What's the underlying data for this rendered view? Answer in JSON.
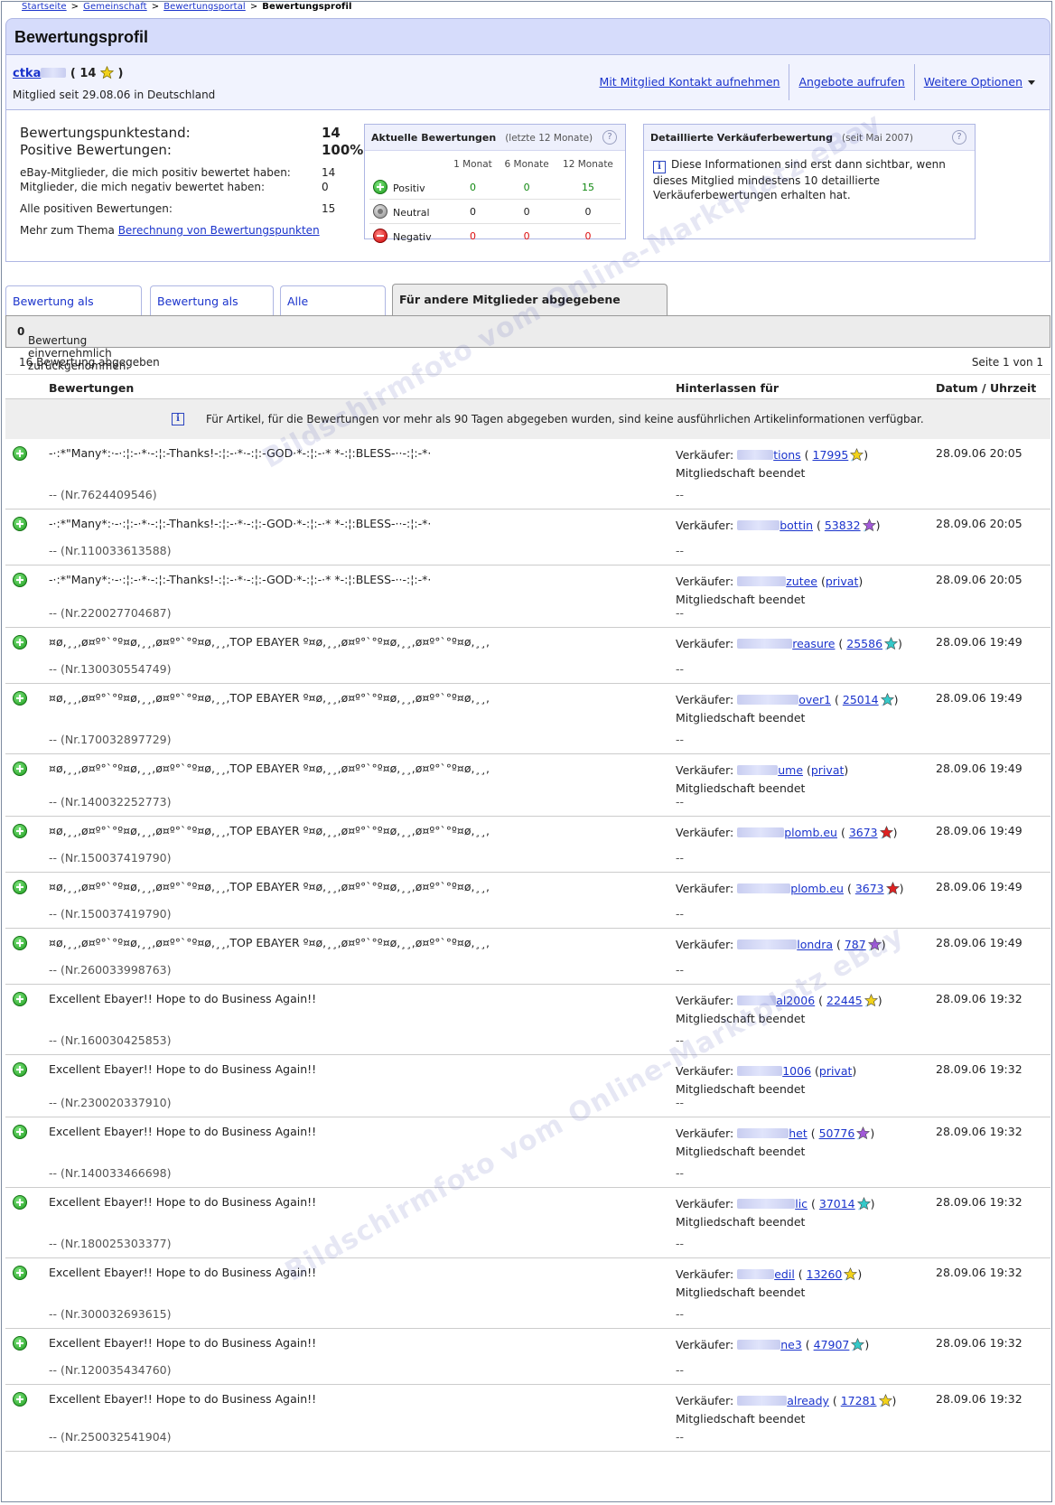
{
  "breadcrumb": [
    "Startseite",
    "Gemeinschaft",
    "Bewertungsportal",
    "Bewertungsprofil"
  ],
  "page_title": "Bewertungsprofil",
  "user": {
    "name": "ctka",
    "score": "14",
    "member_since": "Mitglied seit 29.08.06 in Deutschland"
  },
  "actions": [
    "Mit Mitglied Kontakt aufnehmen",
    "Angebote aufrufen",
    "Weitere Optionen"
  ],
  "summary": {
    "score_label": "Bewertungspunktestand:",
    "score": "14",
    "positive_label": "Positive Bewertungen:",
    "positive": "100%",
    "pos_members_label": "eBay-Mitglieder, die mich positiv bewertet haben:",
    "pos_members": "14",
    "neg_members_label": "Mitglieder, die mich negativ bewertet haben:",
    "neg_members": "0",
    "all_pos_label": "Alle positiven Bewertungen:",
    "all_pos": "15",
    "more_text": "Mehr zum Thema",
    "more_link": "Berechnung von Bewertungspunkten"
  },
  "recent": {
    "title": "Aktuelle Bewertungen",
    "subtitle": "(letzte 12 Monate)",
    "columns": [
      "1 Monat",
      "6 Monate",
      "12 Monate"
    ],
    "rows": [
      {
        "label": "Positiv",
        "values": [
          "0",
          "0",
          "15"
        ]
      },
      {
        "label": "Neutral",
        "values": [
          "0",
          "0",
          "0"
        ]
      },
      {
        "label": "Negativ",
        "values": [
          "0",
          "0",
          "0"
        ]
      }
    ]
  },
  "seller_detail": {
    "title": "Detaillierte Verkäuferbewertung",
    "subtitle": "(seit Mai 2007)",
    "text": "Diese Informationen sind erst dann sichtbar, wenn dieses Mitglied mindestens 10 detaillierte Verkäuferbewertungen erhalten hat."
  },
  "tabs": [
    "Bewertung als Verkäufer",
    "Bewertung als Käufer",
    "Alle Bewertungen",
    "Für andere Mitglieder abgegebene Bewertung"
  ],
  "withdrawn": {
    "label": "Bewertung einvernehmlich zurückgenommen:",
    "count": "0"
  },
  "count_text": "16 Bewertung abgegeben",
  "page_text": "Seite 1 von 1",
  "columns": [
    "Bewertungen",
    "Hinterlassen für",
    "Datum / Uhrzeit"
  ],
  "notice": "Für Artikel, für die Bewertungen vor mehr als 90 Tagen abgegeben wurden, sind keine ausführlichen Artikelinformationen verfügbar.",
  "seller_label": "Verkäufer:",
  "ended_label": "Mitgliedschaft beendet",
  "dash": "--",
  "watermark": "Bildschirmfoto vom Online-Marktplatz eBay",
  "colors": {
    "star_yellow": "#f2d21b",
    "star_purple": "#a25ad8",
    "star_teal": "#35c9c9",
    "star_red": "#dd2222",
    "link": "#1a33cc"
  },
  "entries": [
    {
      "comment": "-·:*\"Many*:·-·:¦:-·*·-:¦:-Thanks!-:¦:-·*·-:¦:-GOD·*-:¦:-·* *-:¦:BLESS-··-:¦:-*·",
      "nr": "-- (Nr.7624409546)",
      "seller": "tions",
      "seller_score": "17995",
      "star": "yellow",
      "ended": true,
      "date": "28.09.06 20:05"
    },
    {
      "comment": "-·:*\"Many*:·-·:¦:-·*·-:¦:-Thanks!-:¦:-·*·-:¦:-GOD·*-:¦:-·* *-:¦:BLESS-··-:¦:-*·",
      "nr": "-- (Nr.110033613588)",
      "seller": "bottin",
      "seller_score": "53832",
      "star": "purple",
      "ended": false,
      "date": "28.09.06 20:05"
    },
    {
      "comment": "-·:*\"Many*:·-·:¦:-·*·-:¦:-Thanks!-:¦:-·*·-:¦:-GOD·*-:¦:-·* *-:¦:BLESS-··-:¦:-*·",
      "nr": "-- (Nr.220027704687)",
      "seller": "zutee",
      "seller_score": "privat",
      "star": "",
      "ended": true,
      "date": "28.09.06 20:05"
    },
    {
      "comment": "¤ø,¸¸,ø¤º°`°º¤ø,¸¸,ø¤º°`°º¤ø,¸¸,TOP EBAYER º¤ø,¸¸,ø¤º°`°º¤ø,¸¸,ø¤º°`°º¤ø,¸¸,",
      "nr": "-- (Nr.130030554749)",
      "seller": "reasure",
      "seller_score": "25586",
      "star": "teal",
      "ended": false,
      "date": "28.09.06 19:49"
    },
    {
      "comment": "¤ø,¸¸,ø¤º°`°º¤ø,¸¸,ø¤º°`°º¤ø,¸¸,TOP EBAYER º¤ø,¸¸,ø¤º°`°º¤ø,¸¸,ø¤º°`°º¤ø,¸¸,",
      "nr": "-- (Nr.170032897729)",
      "seller": "over1",
      "seller_score": "25014",
      "star": "teal",
      "ended": true,
      "date": "28.09.06 19:49"
    },
    {
      "comment": "¤ø,¸¸,ø¤º°`°º¤ø,¸¸,ø¤º°`°º¤ø,¸¸,TOP EBAYER º¤ø,¸¸,ø¤º°`°º¤ø,¸¸,ø¤º°`°º¤ø,¸¸,",
      "nr": "-- (Nr.140032252773)",
      "seller": "ume",
      "seller_score": "privat",
      "star": "",
      "ended": true,
      "date": "28.09.06 19:49"
    },
    {
      "comment": "¤ø,¸¸,ø¤º°`°º¤ø,¸¸,ø¤º°`°º¤ø,¸¸,TOP EBAYER º¤ø,¸¸,ø¤º°`°º¤ø,¸¸,ø¤º°`°º¤ø,¸¸,",
      "nr": "-- (Nr.150037419790)",
      "seller": "plomb.eu",
      "seller_score": "3673",
      "star": "red",
      "ended": false,
      "date": "28.09.06 19:49"
    },
    {
      "comment": "¤ø,¸¸,ø¤º°`°º¤ø,¸¸,ø¤º°`°º¤ø,¸¸,TOP EBAYER º¤ø,¸¸,ø¤º°`°º¤ø,¸¸,ø¤º°`°º¤ø,¸¸,",
      "nr": "-- (Nr.150037419790)",
      "seller": "plomb.eu",
      "seller_score": "3673",
      "star": "red",
      "ended": false,
      "date": "28.09.06 19:49"
    },
    {
      "comment": "¤ø,¸¸,ø¤º°`°º¤ø,¸¸,ø¤º°`°º¤ø,¸¸,TOP EBAYER º¤ø,¸¸,ø¤º°`°º¤ø,¸¸,ø¤º°`°º¤ø,¸¸,",
      "nr": "-- (Nr.260033998763)",
      "seller": "londra",
      "seller_score": "787",
      "star": "purple",
      "ended": false,
      "date": "28.09.06 19:49"
    },
    {
      "comment": "Excellent Ebayer!! Hope to do Business Again!!",
      "nr": "-- (Nr.160030425853)",
      "seller": "al2006",
      "seller_score": "22445",
      "star": "yellow",
      "ended": true,
      "date": "28.09.06 19:32"
    },
    {
      "comment": "Excellent Ebayer!! Hope to do Business Again!!",
      "nr": "-- (Nr.230020337910)",
      "seller": "1006",
      "seller_score": "privat",
      "star": "",
      "ended": true,
      "date": "28.09.06 19:32"
    },
    {
      "comment": "Excellent Ebayer!! Hope to do Business Again!!",
      "nr": "-- (Nr.140033466698)",
      "seller": "het",
      "seller_score": "50776",
      "star": "purple",
      "ended": true,
      "date": "28.09.06 19:32"
    },
    {
      "comment": "Excellent Ebayer!! Hope to do Business Again!!",
      "nr": "-- (Nr.180025303377)",
      "seller": "lic",
      "seller_score": "37014",
      "star": "teal",
      "ended": true,
      "date": "28.09.06 19:32"
    },
    {
      "comment": "Excellent Ebayer!! Hope to do Business Again!!",
      "nr": "-- (Nr.300032693615)",
      "seller": "edil",
      "seller_score": "13260",
      "star": "yellow",
      "ended": true,
      "date": "28.09.06 19:32"
    },
    {
      "comment": "Excellent Ebayer!! Hope to do Business Again!!",
      "nr": "-- (Nr.120035434760)",
      "seller": "ne3",
      "seller_score": "47907",
      "star": "teal",
      "ended": false,
      "date": "28.09.06 19:32"
    },
    {
      "comment": "Excellent Ebayer!! Hope to do Business Again!!",
      "nr": "-- (Nr.250032541904)",
      "seller": "already",
      "seller_score": "17281",
      "star": "yellow",
      "ended": true,
      "date": "28.09.06 19:32"
    }
  ]
}
